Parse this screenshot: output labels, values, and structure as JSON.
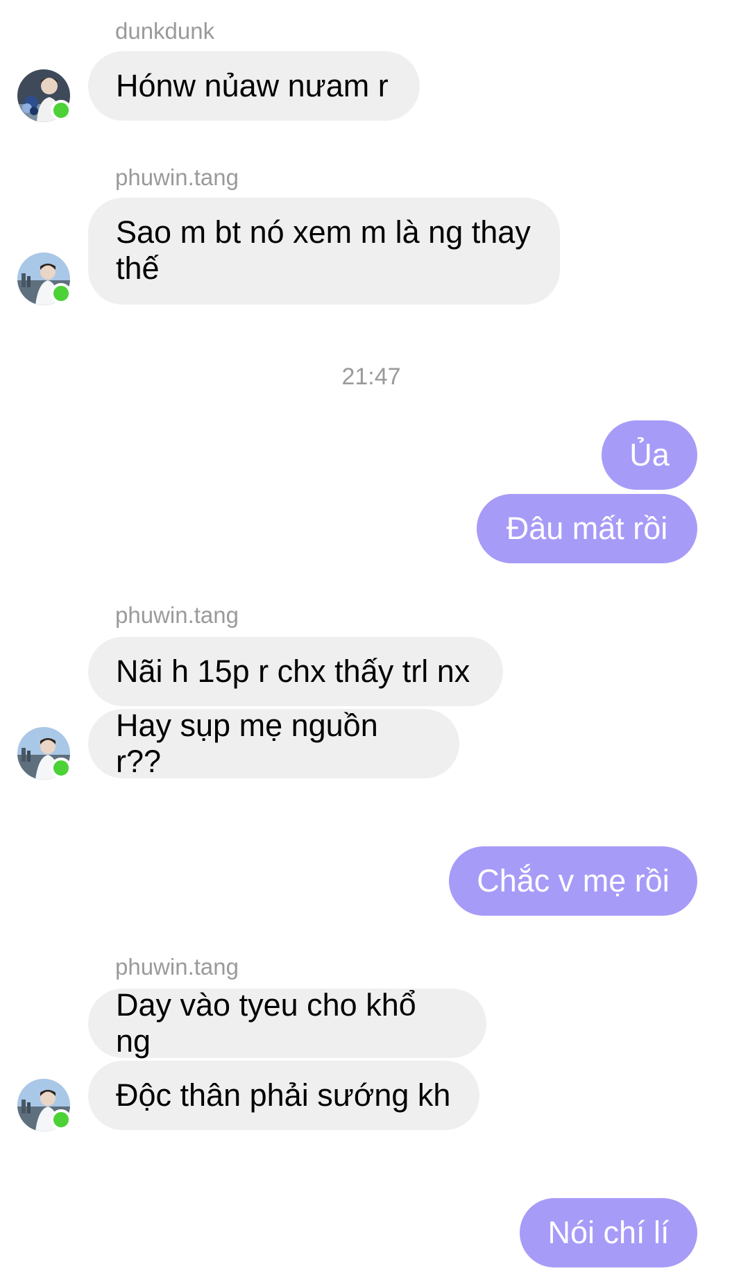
{
  "colors": {
    "incoming_bubble": "#efefef",
    "outgoing_bubble": "#a79bf8",
    "online_dot": "#4cd137",
    "meta_text": "#9a9a9a"
  },
  "messages": [
    {
      "type": "sender",
      "text": "dunkdunk"
    },
    {
      "type": "incoming",
      "text": "Hónw nủaw nưam r"
    },
    {
      "type": "sender",
      "text": "phuwin.tang"
    },
    {
      "type": "incoming",
      "text": "Sao m bt nó xem m là ng thay thế"
    },
    {
      "type": "timestamp",
      "text": "21:47"
    },
    {
      "type": "outgoing",
      "text": "Ủa"
    },
    {
      "type": "outgoing",
      "text": "Đâu mất rồi"
    },
    {
      "type": "sender",
      "text": "phuwin.tang"
    },
    {
      "type": "incoming",
      "text": "Nãi h 15p r chx thấy trl nx"
    },
    {
      "type": "incoming",
      "text": "Hay sụp mẹ nguồn r??"
    },
    {
      "type": "outgoing",
      "text": "Chắc v mẹ rồi"
    },
    {
      "type": "sender",
      "text": "phuwin.tang"
    },
    {
      "type": "incoming",
      "text": "Day vào tyeu cho khổ ng"
    },
    {
      "type": "incoming",
      "text": "Độc thân phải sướng kh"
    },
    {
      "type": "outgoing",
      "text": "Nói chí lí"
    }
  ],
  "avatars": [
    {
      "user": "dunkdunk",
      "icon": "avatar-photo",
      "online": true
    },
    {
      "user": "phuwin.tang",
      "icon": "avatar-photo",
      "online": true
    },
    {
      "user": "phuwin.tang",
      "icon": "avatar-photo",
      "online": true
    },
    {
      "user": "phuwin.tang",
      "icon": "avatar-photo",
      "online": true
    }
  ]
}
